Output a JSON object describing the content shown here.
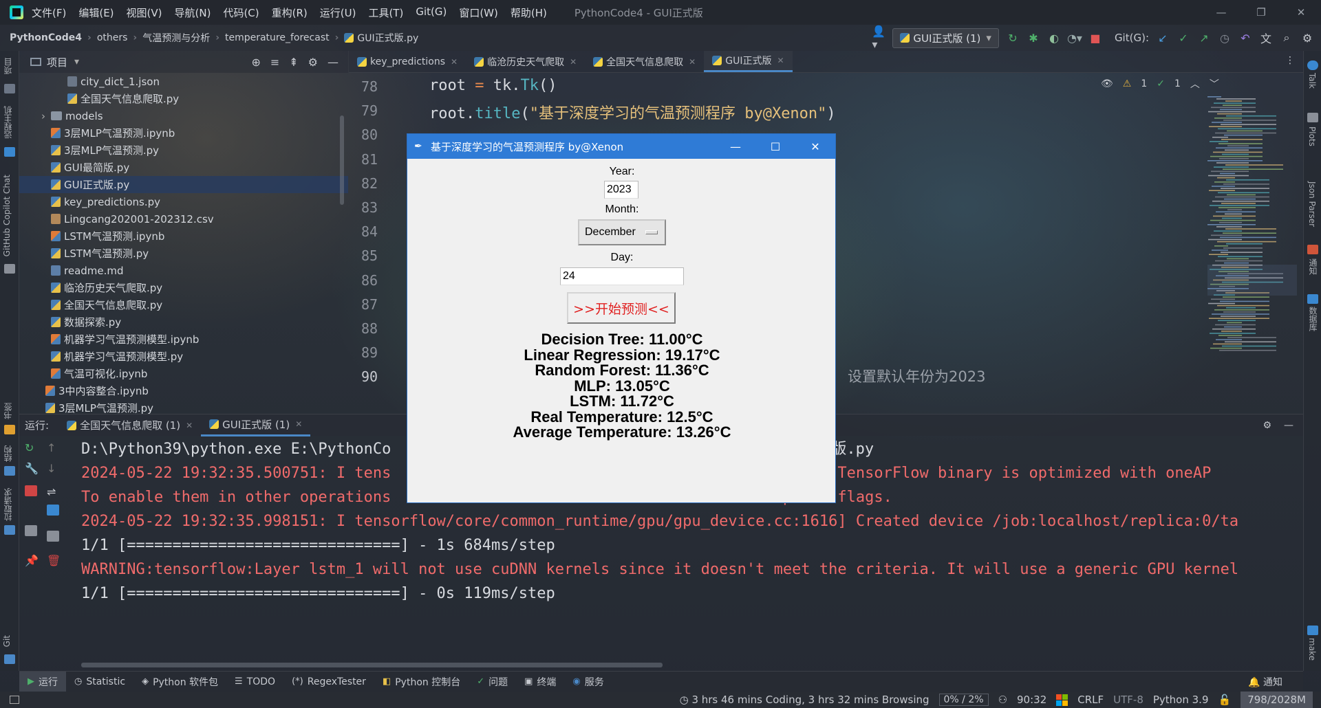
{
  "titlebar": {
    "menu": [
      "文件(F)",
      "编辑(E)",
      "视图(V)",
      "导航(N)",
      "代码(C)",
      "重构(R)",
      "运行(U)",
      "工具(T)",
      "Git(G)",
      "窗口(W)",
      "帮助(H)"
    ],
    "title": "PythonCode4 - GUI正式版"
  },
  "breadcrumb": [
    "PythonCode4",
    "others",
    "气温预测与分析",
    "temperature_forecast",
    "GUI正式版.py"
  ],
  "toolbar": {
    "run_config": "GUI正式版 (1)",
    "git_label": "Git(G):"
  },
  "project_panel": {
    "title": "项目",
    "files": [
      {
        "name": "city_dict_1.json",
        "kind": "json",
        "indent": 2
      },
      {
        "name": "全国天气信息爬取.py",
        "kind": "py",
        "indent": 2
      },
      {
        "name": "models",
        "kind": "folder",
        "indent": 1
      },
      {
        "name": "3层MLP气温预测.ipynb",
        "kind": "nb",
        "indent": 1
      },
      {
        "name": "3层MLP气温预测.py",
        "kind": "py",
        "indent": 1
      },
      {
        "name": "GUI最简版.py",
        "kind": "py",
        "indent": 1
      },
      {
        "name": "GUI正式版.py",
        "kind": "py",
        "indent": 1,
        "selected": true
      },
      {
        "name": "key_predictions.py",
        "kind": "py",
        "indent": 1
      },
      {
        "name": "Lingcang202001-202312.csv",
        "kind": "csv",
        "indent": 1
      },
      {
        "name": "LSTM气温预测.ipynb",
        "kind": "nb",
        "indent": 1
      },
      {
        "name": "LSTM气温预测.py",
        "kind": "py",
        "indent": 1
      },
      {
        "name": "readme.md",
        "kind": "md",
        "indent": 1
      },
      {
        "name": "临沧历史天气爬取.py",
        "kind": "py",
        "indent": 1
      },
      {
        "name": "全国天气信息爬取.py",
        "kind": "py",
        "indent": 1
      },
      {
        "name": "数据探索.py",
        "kind": "py",
        "indent": 1
      },
      {
        "name": "机器学习气温预测模型.ipynb",
        "kind": "nb",
        "indent": 1
      },
      {
        "name": "机器学习气温预测模型.py",
        "kind": "py",
        "indent": 1
      },
      {
        "name": "气温可视化.ipynb",
        "kind": "nb",
        "indent": 1
      },
      {
        "name": "3中内容整合.ipynb",
        "kind": "nb",
        "indent": 0
      },
      {
        "name": "3层MLP气温预测.py",
        "kind": "py",
        "indent": 0
      }
    ]
  },
  "editor_tabs": [
    {
      "label": "key_predictions",
      "active": false
    },
    {
      "label": "临沧历史天气爬取",
      "active": false
    },
    {
      "label": "全国天气信息爬取",
      "active": false
    },
    {
      "label": "GUI正式版",
      "active": true
    }
  ],
  "editor": {
    "line_numbers": [
      "78",
      "79",
      "80",
      "81",
      "82",
      "83",
      "84",
      "85",
      "86",
      "87",
      "88",
      "89",
      "90"
    ],
    "line78": {
      "a": "root ",
      "op": "=",
      "b": " tk.",
      "cls": "Tk",
      "c": "()"
    },
    "line79": {
      "a": "root.",
      "fn": "title",
      "b": "(",
      "str": "\"基于深度学习的气温预测程序 by@Xenon\"",
      "c": ")"
    },
    "hint_comment": "设置默认年份为2023",
    "warnings": "1",
    "weak_warnings": "1"
  },
  "run_panel": {
    "label": "运行:",
    "tabs": [
      {
        "label": "全国天气信息爬取 (1)",
        "active": false
      },
      {
        "label": "GUI正式版 (1)",
        "active": true
      }
    ],
    "lines": [
      {
        "text": "D:\\Python39\\python.exe E:\\PythonCo                                          GUI正式版.py",
        "color": "white"
      },
      {
        "text": "2024-05-22 19:32:35.500751: I tens                                          ] This TensorFlow binary is optimized with oneAP",
        "color": "red"
      },
      {
        "text": "To enable them in other operations                                          mpiler flags.",
        "color": "red"
      },
      {
        "text": "2024-05-22 19:32:35.998151: I tensorflow/core/common_runtime/gpu/gpu_device.cc:1616] Created device /job:localhost/replica:0/ta",
        "color": "red"
      },
      {
        "text": "1/1 [==============================] - 1s 684ms/step",
        "color": "white"
      },
      {
        "text": "WARNING:tensorflow:Layer lstm_1 will not use cuDNN kernels since it doesn't meet the criteria. It will use a generic GPU kernel",
        "color": "red"
      },
      {
        "text": "1/1 [==============================] - 0s 119ms/step",
        "color": "white"
      }
    ]
  },
  "bottom_tools": [
    "运行",
    "Statistic",
    "Python 软件包",
    "TODO",
    "RegexTester",
    "Python 控制台",
    "问题",
    "终端",
    "服务"
  ],
  "notifications": "通知",
  "statusbar": {
    "wakatime": "3 hrs 46 mins Coding, 3 hrs 32 mins Browsing",
    "progress": "0% /   2%",
    "position": "90:32",
    "line_sep": "CRLF",
    "encoding": "UTF-8",
    "interpreter": "Python 3.9",
    "memory": "798/2028M"
  },
  "left_strip": {
    "project": "项目",
    "commit": "远程主机",
    "copilot": "GitHub Copilot Chat",
    "bookmarks": "书签",
    "structure": "结构",
    "pull": "拉取请求",
    "git": "Git"
  },
  "right_strip": {
    "talk": "Talk",
    "plots": "Plots",
    "json": "Json Parser",
    "gitee": "通知",
    "db": "数据库",
    "make": "make"
  },
  "dialog": {
    "title": "基于深度学习的气温预测程序 by@Xenon",
    "year_label": "Year:",
    "year_value": "2023",
    "month_label": "Month:",
    "month_value": "December",
    "day_label": "Day:",
    "day_value": "24",
    "predict_button": ">>开始预测<<",
    "results": [
      "Decision Tree: 11.00°C",
      "Linear Regression: 19.17°C",
      "Random Forest: 11.36°C",
      "MLP: 13.05°C",
      "LSTM: 11.72°C",
      "Real Temperature: 12.5°C",
      "Average Temperature: 13.26°C"
    ]
  },
  "colors": {
    "accent": "#2f7bd6",
    "console_red": "#f06b6b",
    "predict_red": "#e02020"
  }
}
